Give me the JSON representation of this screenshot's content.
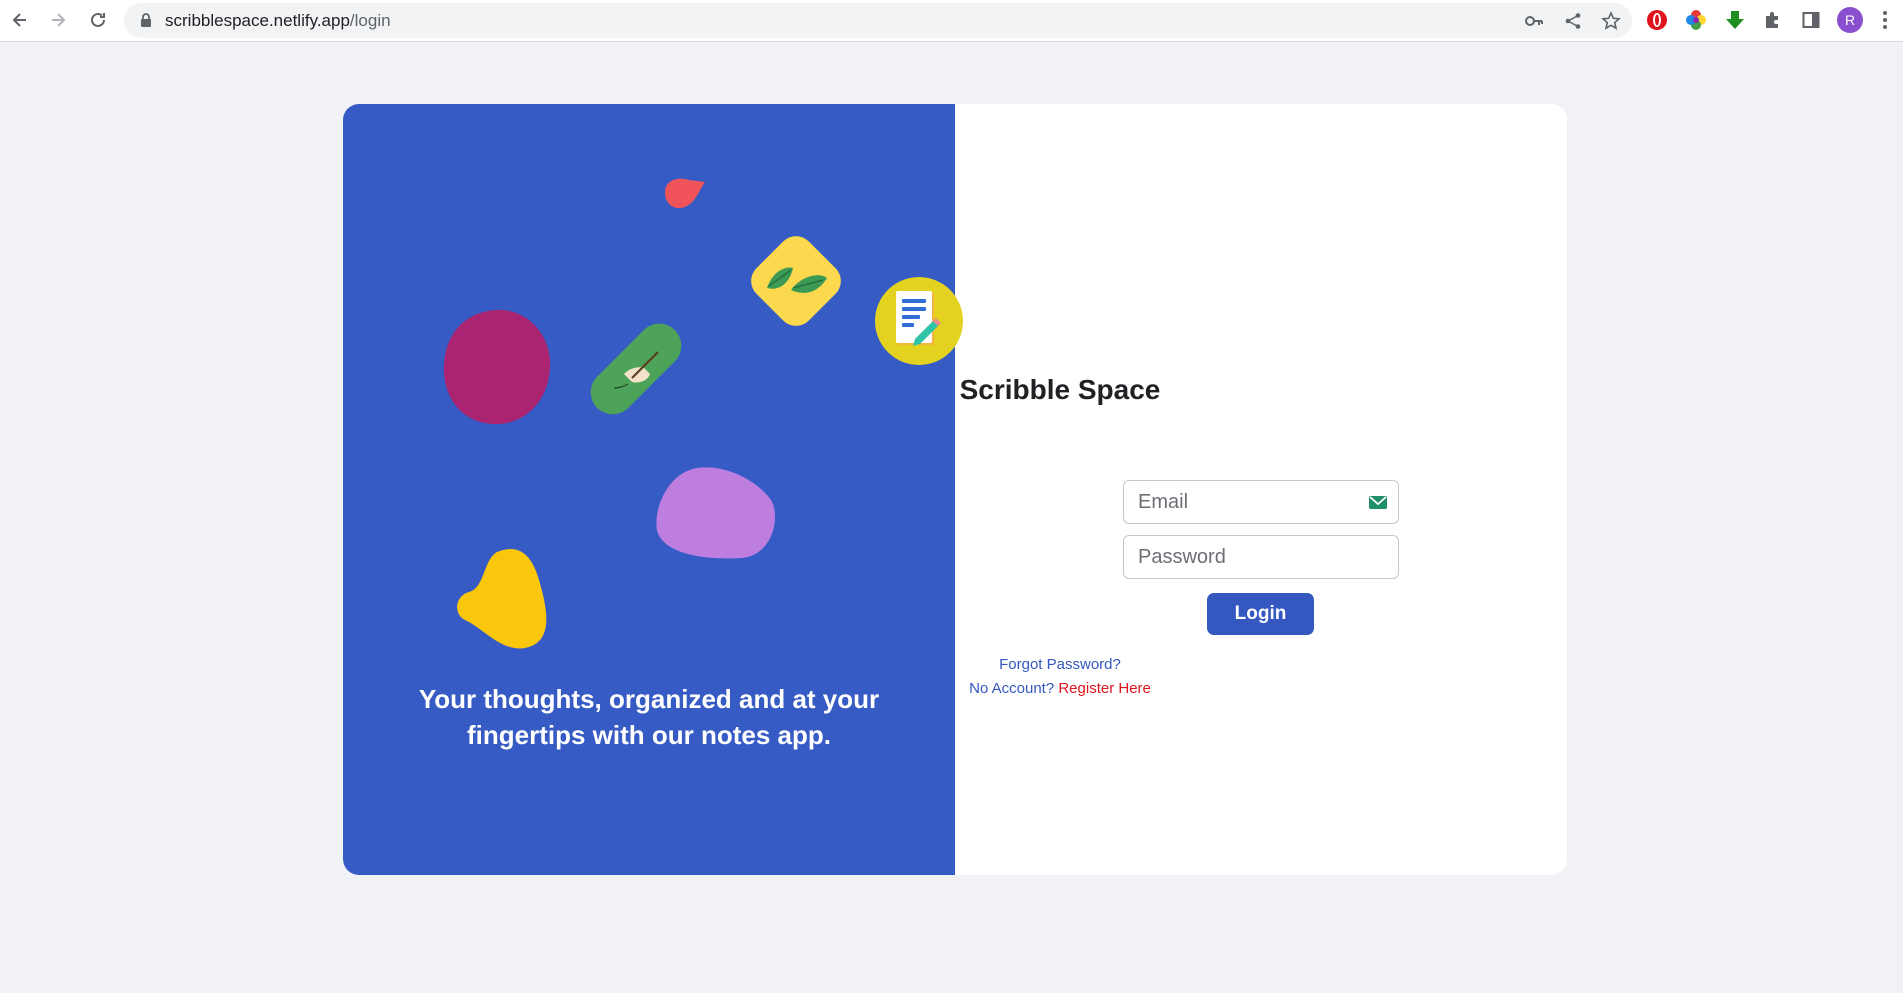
{
  "browser": {
    "url_host": "scribblespace.netlify.app",
    "url_path": "/login",
    "profile_initial": "R",
    "icons": {
      "back": "back-arrow-icon",
      "forward": "forward-arrow-icon",
      "reload": "reload-icon",
      "lock": "lock-icon",
      "key": "key-icon",
      "share": "share-icon",
      "bookmark": "star-icon",
      "extensions": [
        "opera-extension-icon",
        "color-wheel-extension-icon",
        "download-extension-icon",
        "puzzle-icon",
        "side-panel-icon"
      ],
      "menu": "kebab-menu-icon"
    }
  },
  "hero": {
    "tagline": "Your thoughts, organized and at your fingertips with our notes app.",
    "colors": {
      "background": "#375bc4",
      "red_drop": "#f0545a",
      "yellow_square": "#fbd84e",
      "magenta_circle": "#aa2472",
      "green_pill": "#4ea35a",
      "purple_blob": "#bd7ee0",
      "yellow_blob": "#fbc70c"
    }
  },
  "login": {
    "app_title": "Scribble Space",
    "email_placeholder": "Email",
    "password_placeholder": "Password",
    "login_label": "Login",
    "forgot_label": "Forgot Password?",
    "no_account_label": "No Account?",
    "register_label": "Register Here"
  },
  "colors": {
    "page_bg": "#f1f2f5",
    "accent": "#3457c0",
    "register_link": "#e0141e",
    "logo_bg": "#e3d21f"
  }
}
